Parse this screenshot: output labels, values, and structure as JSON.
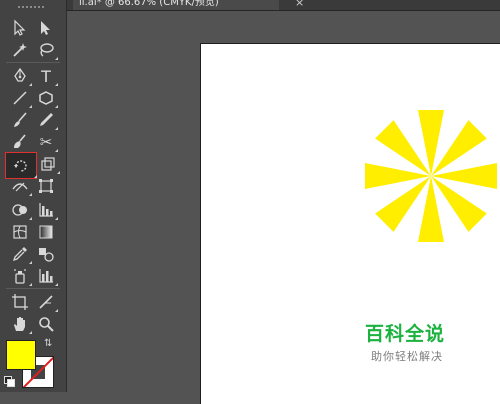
{
  "document_tab": {
    "title": "li.ai* @ 66.67% (CMYK/预览)",
    "close_glyph": "×"
  },
  "tools": [
    {
      "name": "selection-tool-icon"
    },
    {
      "name": "direct-selection-tool-icon"
    },
    {
      "name": "magic-wand-tool-icon"
    },
    {
      "name": "lasso-tool-icon"
    },
    {
      "name": "pen-tool-icon"
    },
    {
      "name": "type-tool-icon",
      "glyph": "T"
    },
    {
      "name": "line-segment-tool-icon"
    },
    {
      "name": "polygon-tool-icon"
    },
    {
      "name": "paintbrush-tool-icon"
    },
    {
      "name": "pencil-tool-icon"
    },
    {
      "name": "blob-brush-tool-icon"
    },
    {
      "name": "scissors-tool-icon",
      "glyph": "✂"
    },
    {
      "name": "rotate-tool-icon",
      "selected": true
    },
    {
      "name": "scale-tool-icon"
    },
    {
      "name": "width-tool-icon"
    },
    {
      "name": "free-transform-tool-icon"
    },
    {
      "name": "shape-builder-tool-icon"
    },
    {
      "name": "column-graph-tool-icon"
    },
    {
      "name": "mesh-tool-icon"
    },
    {
      "name": "gradient-tool-icon"
    },
    {
      "name": "eyedropper-tool-icon"
    },
    {
      "name": "blend-tool-icon"
    },
    {
      "name": "symbol-sprayer-tool-icon"
    },
    {
      "name": "bar-graph-tool-icon"
    },
    {
      "name": "artboard-tool-icon"
    },
    {
      "name": "slice-tool-icon"
    },
    {
      "name": "hand-tool-icon"
    },
    {
      "name": "zoom-tool-icon"
    }
  ],
  "colors": {
    "fill": "#ffff00",
    "stroke": "none",
    "star": "#ffee00",
    "selected_highlight": "#e03030",
    "watermark_title": "#1db23f"
  },
  "watermark": {
    "title": "百科全说",
    "subtitle": "助你轻松解决"
  }
}
